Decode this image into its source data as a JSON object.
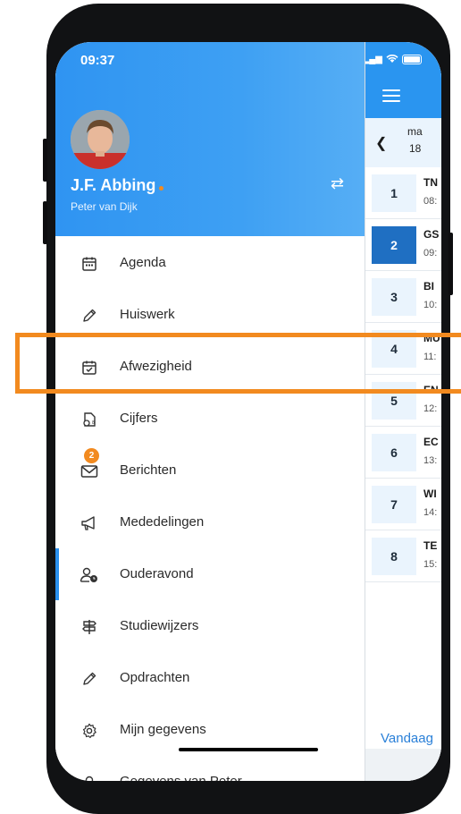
{
  "status_bar": {
    "time": "09:37"
  },
  "profile": {
    "name": "J.F. Abbing",
    "subtitle": "Peter van Dijk"
  },
  "menu": [
    {
      "label": "Agenda",
      "icon": "calendar-icon"
    },
    {
      "label": "Huiswerk",
      "icon": "pencil-icon"
    },
    {
      "label": "Afwezigheid",
      "icon": "calendar-check-icon"
    },
    {
      "label": "Cijfers",
      "icon": "grades-icon"
    },
    {
      "label": "Berichten",
      "icon": "mail-icon",
      "badge": "2"
    },
    {
      "label": "Mededelingen",
      "icon": "megaphone-icon"
    },
    {
      "label": "Ouderavond",
      "icon": "parent-meeting-icon",
      "active": true
    },
    {
      "label": "Studiewijzers",
      "icon": "signpost-icon"
    },
    {
      "label": "Opdrachten",
      "icon": "pencil-icon"
    },
    {
      "label": "Mijn gegevens",
      "icon": "gear-icon"
    },
    {
      "label": "Gegevens van Peter",
      "icon": "person-icon"
    }
  ],
  "schedule": {
    "day_name": "ma",
    "day_number": "18",
    "lessons": [
      {
        "num": "1",
        "code": "TN",
        "time": "08:"
      },
      {
        "num": "2",
        "code": "GS",
        "time": "09:",
        "active": true
      },
      {
        "num": "3",
        "code": "BI",
        "time": "10:"
      },
      {
        "num": "4",
        "code": "MU",
        "time": "11:"
      },
      {
        "num": "5",
        "code": "EN",
        "time": "12:"
      },
      {
        "num": "6",
        "code": "EC",
        "time": "13:"
      },
      {
        "num": "7",
        "code": "WI",
        "time": "14:"
      },
      {
        "num": "8",
        "code": "TE",
        "time": "15:"
      }
    ],
    "today_button": "Vandaag"
  },
  "colors": {
    "header_blue": "#3399F2",
    "active_blue": "#1F6FC2",
    "accent_orange": "#F28A1F",
    "highlight": "#F28A1F"
  }
}
